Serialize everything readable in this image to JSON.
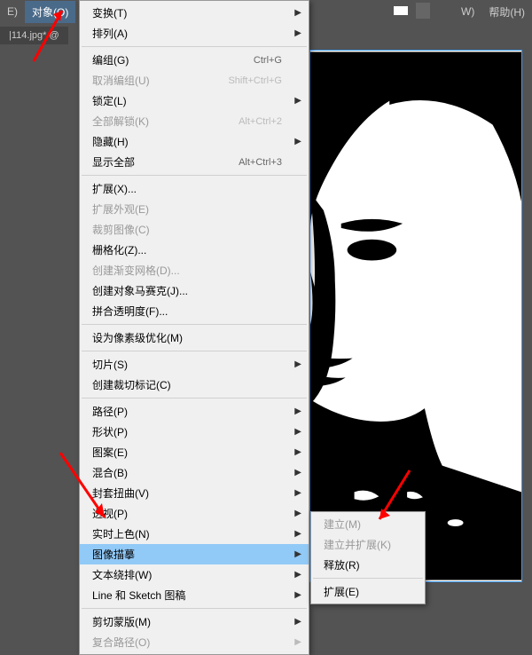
{
  "menubar": {
    "items": [
      {
        "label": "E)"
      },
      {
        "label": "对象(O)"
      },
      {
        "label": "W)"
      },
      {
        "label": "帮助(H)"
      }
    ]
  },
  "docTab": {
    "label": "|114.jpg* @ "
  },
  "mainMenu": {
    "items": [
      {
        "label": "变换(T)",
        "shortcut": "",
        "arrow": true,
        "disabled": false
      },
      {
        "label": "排列(A)",
        "shortcut": "",
        "arrow": true,
        "disabled": false
      },
      {
        "type": "separator"
      },
      {
        "label": "编组(G)",
        "shortcut": "Ctrl+G",
        "arrow": false,
        "disabled": false
      },
      {
        "label": "取消编组(U)",
        "shortcut": "Shift+Ctrl+G",
        "arrow": false,
        "disabled": true
      },
      {
        "label": "锁定(L)",
        "shortcut": "",
        "arrow": true,
        "disabled": false
      },
      {
        "label": "全部解锁(K)",
        "shortcut": "Alt+Ctrl+2",
        "arrow": false,
        "disabled": true
      },
      {
        "label": "隐藏(H)",
        "shortcut": "",
        "arrow": true,
        "disabled": false
      },
      {
        "label": "显示全部",
        "shortcut": "Alt+Ctrl+3",
        "arrow": false,
        "disabled": false
      },
      {
        "type": "separator"
      },
      {
        "label": "扩展(X)...",
        "shortcut": "",
        "arrow": false,
        "disabled": false
      },
      {
        "label": "扩展外观(E)",
        "shortcut": "",
        "arrow": false,
        "disabled": true
      },
      {
        "label": "裁剪图像(C)",
        "shortcut": "",
        "arrow": false,
        "disabled": true
      },
      {
        "label": "栅格化(Z)...",
        "shortcut": "",
        "arrow": false,
        "disabled": false
      },
      {
        "label": "创建渐变网格(D)...",
        "shortcut": "",
        "arrow": false,
        "disabled": true
      },
      {
        "label": "创建对象马赛克(J)...",
        "shortcut": "",
        "arrow": false,
        "disabled": false
      },
      {
        "label": "拼合透明度(F)...",
        "shortcut": "",
        "arrow": false,
        "disabled": false
      },
      {
        "type": "separator"
      },
      {
        "label": "设为像素级优化(M)",
        "shortcut": "",
        "arrow": false,
        "disabled": false
      },
      {
        "type": "separator"
      },
      {
        "label": "切片(S)",
        "shortcut": "",
        "arrow": true,
        "disabled": false
      },
      {
        "label": "创建裁切标记(C)",
        "shortcut": "",
        "arrow": false,
        "disabled": false
      },
      {
        "type": "separator"
      },
      {
        "label": "路径(P)",
        "shortcut": "",
        "arrow": true,
        "disabled": false
      },
      {
        "label": "形状(P)",
        "shortcut": "",
        "arrow": true,
        "disabled": false
      },
      {
        "label": "图案(E)",
        "shortcut": "",
        "arrow": true,
        "disabled": false
      },
      {
        "label": "混合(B)",
        "shortcut": "",
        "arrow": true,
        "disabled": false
      },
      {
        "label": "封套扭曲(V)",
        "shortcut": "",
        "arrow": true,
        "disabled": false
      },
      {
        "label": "透视(P)",
        "shortcut": "",
        "arrow": true,
        "disabled": false
      },
      {
        "label": "实时上色(N)",
        "shortcut": "",
        "arrow": true,
        "disabled": false
      },
      {
        "label": "图像描摹",
        "shortcut": "",
        "arrow": true,
        "disabled": false,
        "highlighted": true
      },
      {
        "label": "文本绕排(W)",
        "shortcut": "",
        "arrow": true,
        "disabled": false
      },
      {
        "label": "Line 和 Sketch 图稿",
        "shortcut": "",
        "arrow": true,
        "disabled": false
      },
      {
        "type": "separator"
      },
      {
        "label": "剪切蒙版(M)",
        "shortcut": "",
        "arrow": true,
        "disabled": false
      },
      {
        "label": "复合路径(O)",
        "shortcut": "",
        "arrow": true,
        "disabled": true
      }
    ]
  },
  "submenu": {
    "items": [
      {
        "label": "建立(M)",
        "disabled": true
      },
      {
        "label": "建立并扩展(K)",
        "disabled": true
      },
      {
        "label": "释放(R)",
        "disabled": false
      },
      {
        "type": "separator"
      },
      {
        "label": "扩展(E)",
        "disabled": false
      }
    ]
  }
}
